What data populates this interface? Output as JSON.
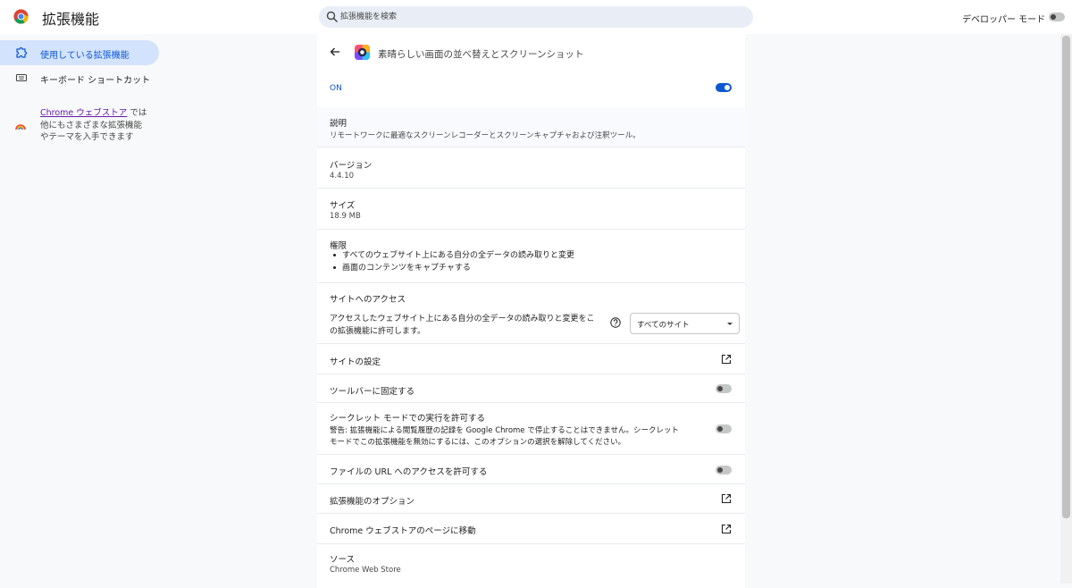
{
  "header": {
    "title": "拡張機能",
    "search_placeholder": "拡張機能を検索",
    "dev_mode_label": "デベロッパー モード",
    "dev_mode_on": false
  },
  "sidebar": {
    "items": [
      {
        "label": "使用している拡張機能",
        "icon": "puzzle-icon",
        "active": true
      },
      {
        "label": "キーボード ショートカット",
        "icon": "keyboard-icon",
        "active": false
      }
    ],
    "store_link": "Chrome ウェブストア",
    "store_text_1": " では",
    "store_text_2": "他にもさまざまな拡張機能",
    "store_text_3": "やテーマを入手できます"
  },
  "extension": {
    "name": "素晴らしい画面の並べ替えとスクリーンショット",
    "status_label": "ON",
    "enabled": true,
    "description_title": "説明",
    "description": "リモートワークに最適なスクリーンレコーダーとスクリーンキャプチャおよび注釈ツール。",
    "version_title": "バージョン",
    "version": "4.4.10",
    "size_title": "サイズ",
    "size": "18.9 MB",
    "permissions_title": "権限",
    "permissions": [
      "すべてのウェブサイト上にある自分の全データの読み取りと変更",
      "画面のコンテンツをキャプチャする"
    ],
    "site_access_title": "サイトへのアクセス",
    "site_access_desc_1": "アクセスしたウェブサイト上にある自分の全データの読み取りと変更をこ",
    "site_access_desc_2": "の拡張機能に許可します。",
    "site_access_value": "すべてのサイト",
    "site_settings": "サイトの設定",
    "pin_toolbar": "ツールバーに固定する",
    "pin_toolbar_on": false,
    "incognito_title": "シークレット モードでの実行を許可する",
    "incognito_warning_1": "警告: 拡張機能による閲覧履歴の記録を Google Chrome で停止することはできません。シークレット",
    "incognito_warning_2": "モードでこの拡張機能を無効にするには、このオプションの選択を解除してください。",
    "incognito_on": false,
    "file_url": "ファイルの URL へのアクセスを許可する",
    "file_url_on": false,
    "options": "拡張機能のオプション",
    "store_page": "Chrome ウェブストアのページに移動",
    "source_title": "ソース",
    "source": "Chrome Web Store"
  },
  "colors": {
    "accent": "#0b57d0",
    "active_nav_bg": "#d3e3fd",
    "link": "#681da8"
  }
}
